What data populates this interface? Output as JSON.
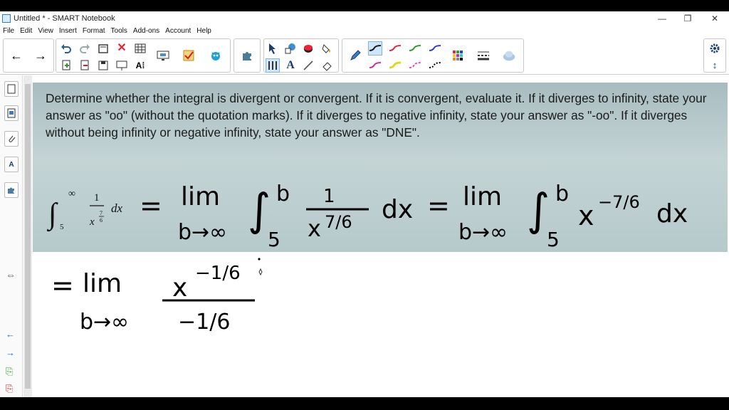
{
  "window": {
    "title": "Untitled * - SMART Notebook"
  },
  "window_controls": {
    "minimize": "—",
    "maximize": "❐",
    "close": "✕"
  },
  "menu": [
    "File",
    "Edit",
    "View",
    "Insert",
    "Format",
    "Tools",
    "Add-ons",
    "Account",
    "Help"
  ],
  "toolbar": {
    "nav": {
      "back": "←",
      "forward": "→"
    },
    "edit_icons": [
      "undo-icon",
      "redo-icon",
      "new-page-icon",
      "delete-icon",
      "table-icon",
      "screen-shade-icon",
      "check-icon",
      "monster-icon"
    ],
    "file_icons": [
      "add-page-icon",
      "remove-page-icon",
      "save-icon",
      "presentation-icon",
      "insert-text-icon"
    ],
    "tools_icons": [
      "select-icon",
      "shapes-icon",
      "eraser-icon",
      "fill-icon",
      "measure-icon",
      "text-icon",
      "line-icon",
      "erase-ink-icon"
    ],
    "pen_icon": "pen-icon",
    "pen_colors": [
      "#1a1a1a",
      "#e0283a",
      "#2ca02c",
      "#2f3fd0",
      "#d02aa8",
      "#e3d51a",
      "#e84ab6",
      "#000000"
    ],
    "palette_icon": "palette-icon",
    "line_style_icon": "line-style-icon",
    "cloud_icon": "cloud-icon",
    "settings_icon": "gear-icon",
    "move_icon": "move-toolbar-icon"
  },
  "sidebar": {
    "tabs": [
      "page-sorter-icon",
      "gallery-icon",
      "attachments-icon",
      "properties-icon",
      "add-ons-icon"
    ],
    "bottom_icons": [
      "previous-page-icon",
      "next-page-icon",
      "add-page-icon",
      "delete-page-icon"
    ]
  },
  "problem": {
    "prompt": "Determine whether the integral is divergent or convergent. If it is convergent, evaluate it. If it diverges to infinity, state your answer as \"oo\" (without the quotation marks). If it diverges to negative infinity, state your answer as \"-oo\". If it diverges without being infinity or negative infinity, state your answer as \"DNE\".",
    "integral_upper": "∞",
    "integral_lower": "5",
    "integrand_num": "1",
    "integrand_den_base": "x",
    "exp_num": "7",
    "exp_den": "6",
    "dx": "dx"
  },
  "handwriting": {
    "eq1": "=",
    "lim": "lim",
    "b_to_inf": "b→∞",
    "upper_b": "b",
    "lower_5": "5",
    "one": "1",
    "x": "x",
    "exp_7_6": "7/6",
    "dx": "dx",
    "eq2": "=",
    "neg_exp_7_6": "−7/6",
    "eq3": "=",
    "num_x": "x",
    "neg_exp_1_6": "−1/6",
    "den_neg_1_6": "−1/6"
  }
}
